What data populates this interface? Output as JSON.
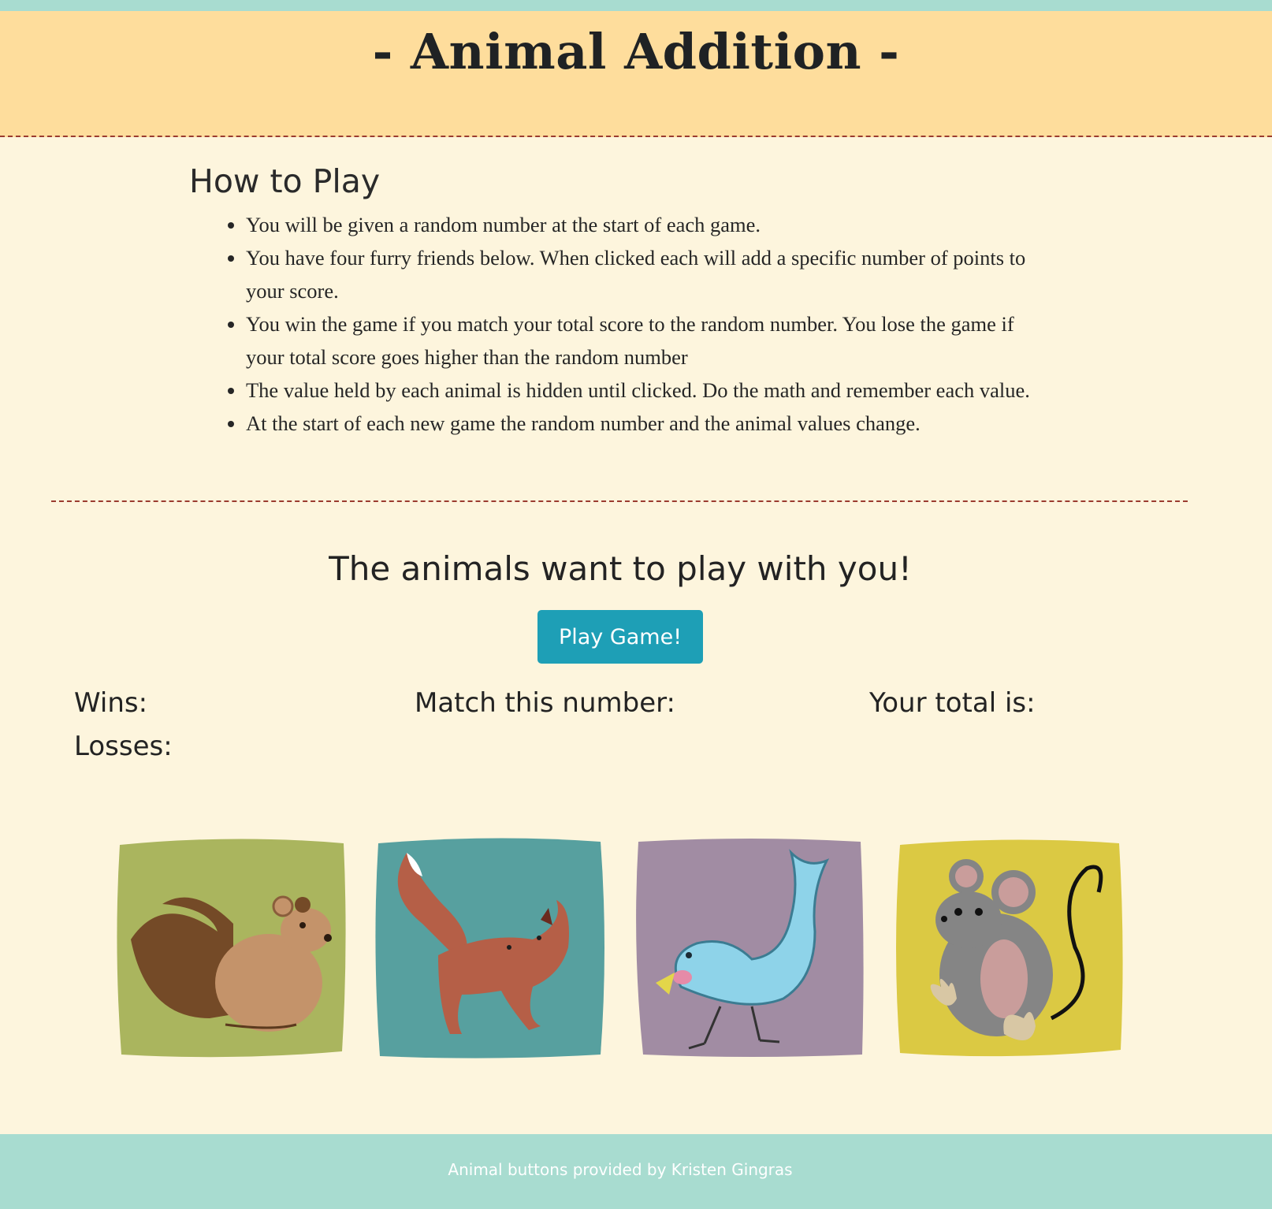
{
  "header": {
    "title": "- Animal Addition -"
  },
  "instructions": {
    "heading": "How to Play",
    "rules": [
      "You will be given a random number at the start of each game.",
      "You have four furry friends below. When clicked each will add a specific number of points to your score.",
      "You win the game if you match your total score to the random number. You lose the game if your total score goes higher than the random number",
      "The value held by each animal is hidden until clicked. Do the math and remember each value.",
      "At the start of each new game the random number and the animal values change."
    ]
  },
  "game": {
    "tagline": "The animals want to play with you!",
    "play_button_label": "Play Game!",
    "wins_label": "Wins:",
    "losses_label": "Losses:",
    "target_label": "Match this number:",
    "total_label": "Your total is:"
  },
  "animals": [
    {
      "name": "squirrel",
      "icon": "squirrel-icon",
      "color": "#aab55e"
    },
    {
      "name": "fox",
      "icon": "fox-icon",
      "color": "#57a09f"
    },
    {
      "name": "bird",
      "icon": "bird-icon",
      "color": "#a18ca3"
    },
    {
      "name": "mouse",
      "icon": "mouse-icon",
      "color": "#dbc943"
    }
  ],
  "colors": {
    "header_bg": "#fedd9c",
    "page_bg": "#fdf5dd",
    "divider": "#9b3b2f",
    "button_bg": "#1e9fb6",
    "footer_bg": "#a8dcd0"
  },
  "footer": {
    "credit": "Animal buttons provided by Kristen Gingras"
  }
}
